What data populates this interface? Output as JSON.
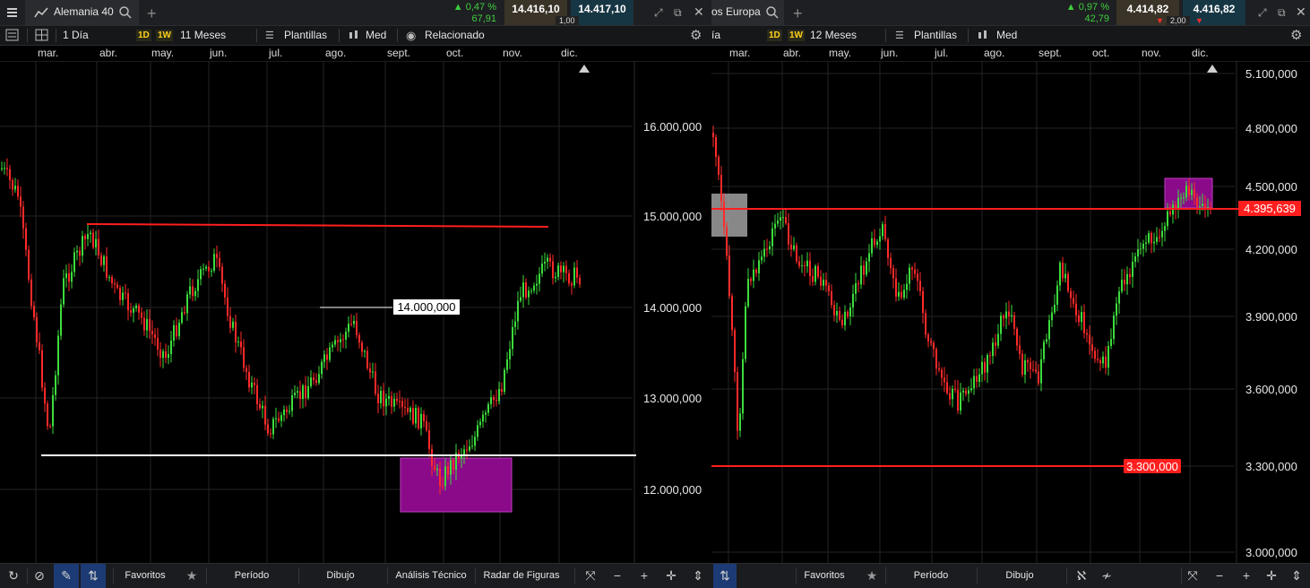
{
  "left": {
    "topbar": {
      "symbol": "Alemania 40",
      "change_pct": "0,47 %",
      "change_abs": "67,91",
      "bid": "14.416,10",
      "ask": "14.417,10",
      "spread": "1,00"
    },
    "toolbar": {
      "interval": "1 Día",
      "tag_1d": "1D",
      "tag_1w": "1W",
      "range": "11 Meses",
      "templates": "Plantillas",
      "price_type": "Med",
      "related": "Relacionado"
    },
    "months": [
      "mar.",
      "abr.",
      "may.",
      "jun.",
      "jul.",
      "ago.",
      "sept.",
      "oct.",
      "nov.",
      "dic."
    ],
    "y_axis": [
      "16.000,000",
      "15.000,000",
      "14.000,000",
      "13.000,000",
      "12.000,000"
    ],
    "annotation": "14.000,000",
    "bottombar": {
      "favorites": "Favoritos",
      "period": "Período",
      "drawing": "Dibujo",
      "technical": "Análisis Técnico",
      "patterns": "Radar de Figuras"
    },
    "colors": {
      "up": "#3ddc3d",
      "down": "#ff2a2a",
      "resistance": "#ff2020",
      "support": "#ffffff",
      "zone": "#a020a0"
    }
  },
  "right": {
    "topbar": {
      "symbol": "os Europa",
      "change_pct": "0,97 %",
      "change_abs": "42,79",
      "bid": "4.414,82",
      "ask": "4.416,82",
      "spread": "2,00"
    },
    "toolbar": {
      "interval": "ía",
      "tag_1d": "1D",
      "tag_1w": "1W",
      "range": "12 Meses",
      "templates": "Plantillas",
      "price_type": "Med"
    },
    "months": [
      "mar.",
      "abr.",
      "may.",
      "jun.",
      "jul.",
      "ago.",
      "sept.",
      "oct.",
      "nov.",
      "dic."
    ],
    "y_axis": [
      "5.100,000",
      "4.800,000",
      "4.500,000",
      "4.200,000",
      "3.900,000",
      "3.600,000",
      "3.300,000",
      "3.000,000"
    ],
    "level_labels": [
      "4.395,639",
      "3.300,000"
    ],
    "bottombar": {
      "favorites": "Favoritos",
      "period": "Período",
      "drawing": "Dibujo"
    }
  }
}
